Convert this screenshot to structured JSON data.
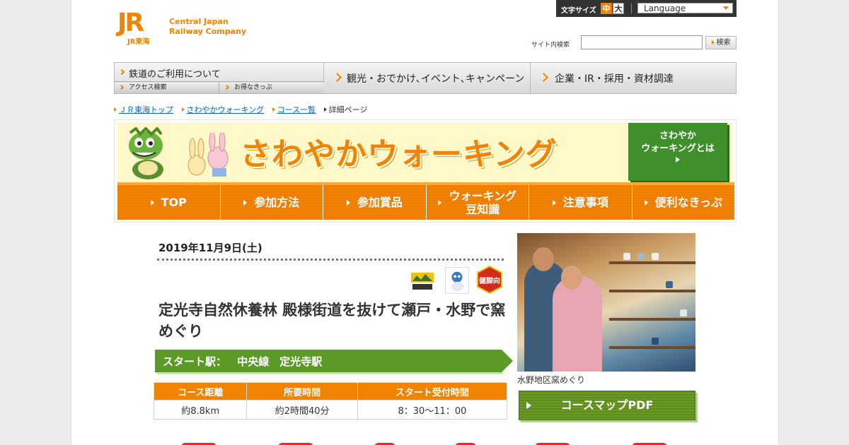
{
  "utility": {
    "font_size_label": "文字サイズ",
    "font_mid": "中",
    "font_large": "大",
    "language": "Language"
  },
  "logo": {
    "mark": "JR",
    "sub": "JR東海",
    "company_line1": "Central Japan",
    "company_line2": "Railway Company"
  },
  "search": {
    "label": "サイト内検索",
    "placeholder": "",
    "button": "検索"
  },
  "global_nav": {
    "main": "鉄道のご利用について",
    "sub1": "アクセス検索",
    "sub2": "お得なきっぷ",
    "item2": "観光・おでかけ､イベント､キャンペーン",
    "item3": "企業・IR・採用・資材調達"
  },
  "breadcrumb": [
    "ＪＲ東海トップ",
    "さわやかウォーキング",
    "コース一覧",
    "詳細ページ"
  ],
  "banner": {
    "title": "さわやかウォーキング",
    "about_line1": "さわやか",
    "about_line2": "ウォーキングとは"
  },
  "section_nav": [
    {
      "label": "TOP"
    },
    {
      "label": "参加方法"
    },
    {
      "label": "参加賞品"
    },
    {
      "label_line1": "ウォーキング",
      "label_line2": "豆知識"
    },
    {
      "label": "注意事項"
    },
    {
      "label": "便利なきっぷ"
    }
  ],
  "course": {
    "date": "2019年11月9日(土)",
    "badge_health": "健脚向",
    "title": "定光寺自然休養林 殿様街道を抜けて瀬戸・水野で窯めぐり",
    "start_label": "スタート駅：",
    "start_station": "中央線　定光寺駅",
    "table_headers": [
      "コース距離",
      "所要時間",
      "スタート受付時間"
    ],
    "table_values": [
      "約8.8km",
      "約2時間40分",
      "8：30～11：00"
    ],
    "photo_caption": "水野地区窯めぐり",
    "pdf_button": "コースマップPDF"
  },
  "colors": {
    "brand_orange": "#f08300",
    "green": "#5c9a28",
    "link": "#0066cc"
  }
}
